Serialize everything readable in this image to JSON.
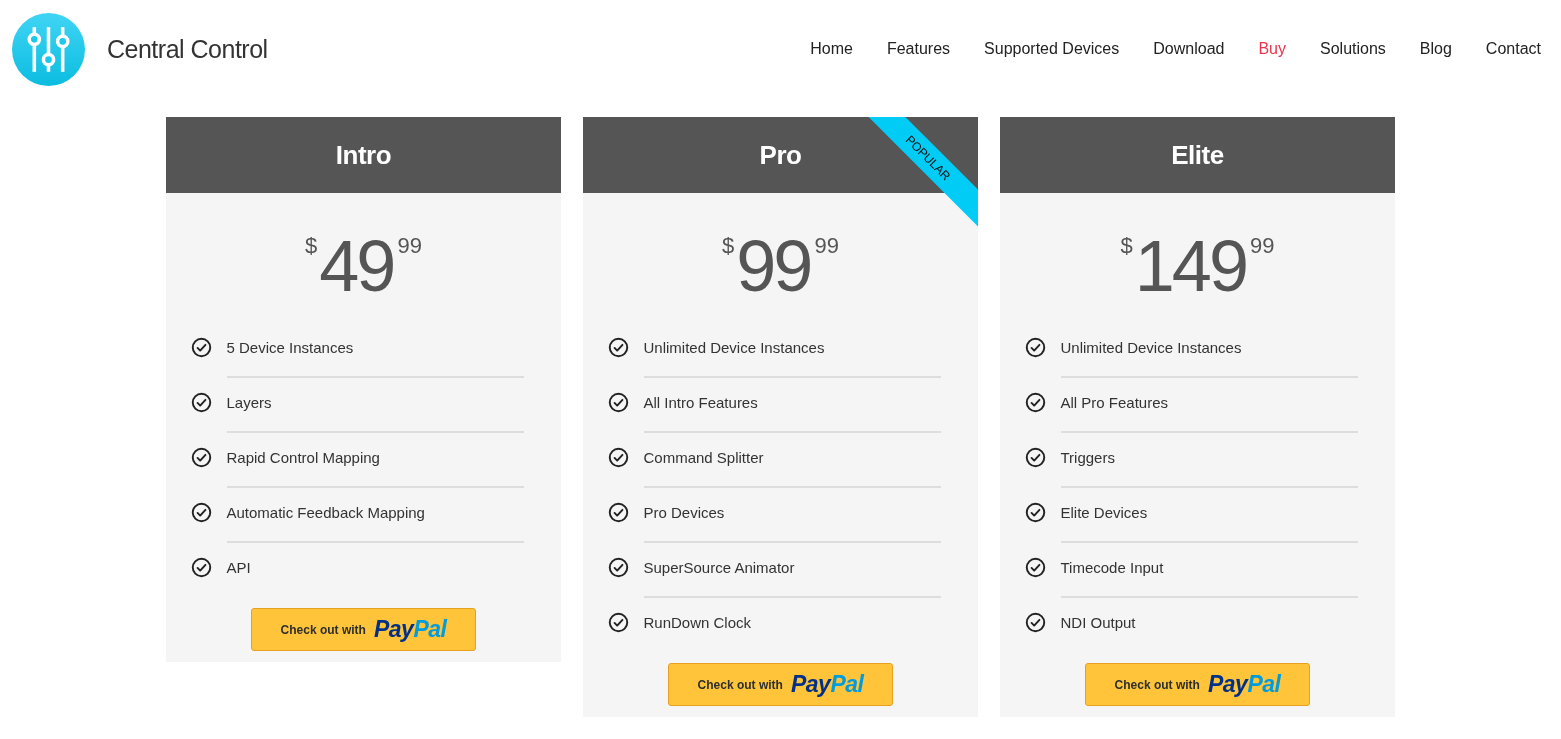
{
  "brand": {
    "name": "Central Control"
  },
  "nav": [
    {
      "label": "Home",
      "selected": false
    },
    {
      "label": "Features",
      "selected": false
    },
    {
      "label": "Supported Devices",
      "selected": false
    },
    {
      "label": "Download",
      "selected": false
    },
    {
      "label": "Buy",
      "selected": true
    },
    {
      "label": "Solutions",
      "selected": false
    },
    {
      "label": "Blog",
      "selected": false
    },
    {
      "label": "Contact",
      "selected": false
    }
  ],
  "plans": [
    {
      "name": "Intro",
      "currency": "$",
      "price": "49",
      "cents": "99",
      "features": [
        "5 Device Instances",
        "Layers",
        "Rapid Control Mapping",
        "Automatic Feedback Mapping",
        "API"
      ],
      "button": {
        "text": "Check out with",
        "brand_left": "Pay",
        "brand_right": "Pal"
      }
    },
    {
      "name": "Pro",
      "ribbon": "POPULAR",
      "currency": "$",
      "price": "99",
      "cents": "99",
      "features": [
        "Unlimited Device Instances",
        "All Intro Features",
        "Command Splitter",
        "Pro Devices",
        "SuperSource Animator",
        "RunDown Clock"
      ],
      "button": {
        "text": "Check out with",
        "brand_left": "Pay",
        "brand_right": "Pal"
      }
    },
    {
      "name": "Elite",
      "currency": "$",
      "price": "149",
      "cents": "99",
      "features": [
        "Unlimited Device Instances",
        "All Pro Features",
        "Triggers",
        "Elite Devices",
        "Timecode Input",
        "NDI Output"
      ],
      "button": {
        "text": "Check out with",
        "brand_left": "Pay",
        "brand_right": "Pal"
      }
    }
  ]
}
